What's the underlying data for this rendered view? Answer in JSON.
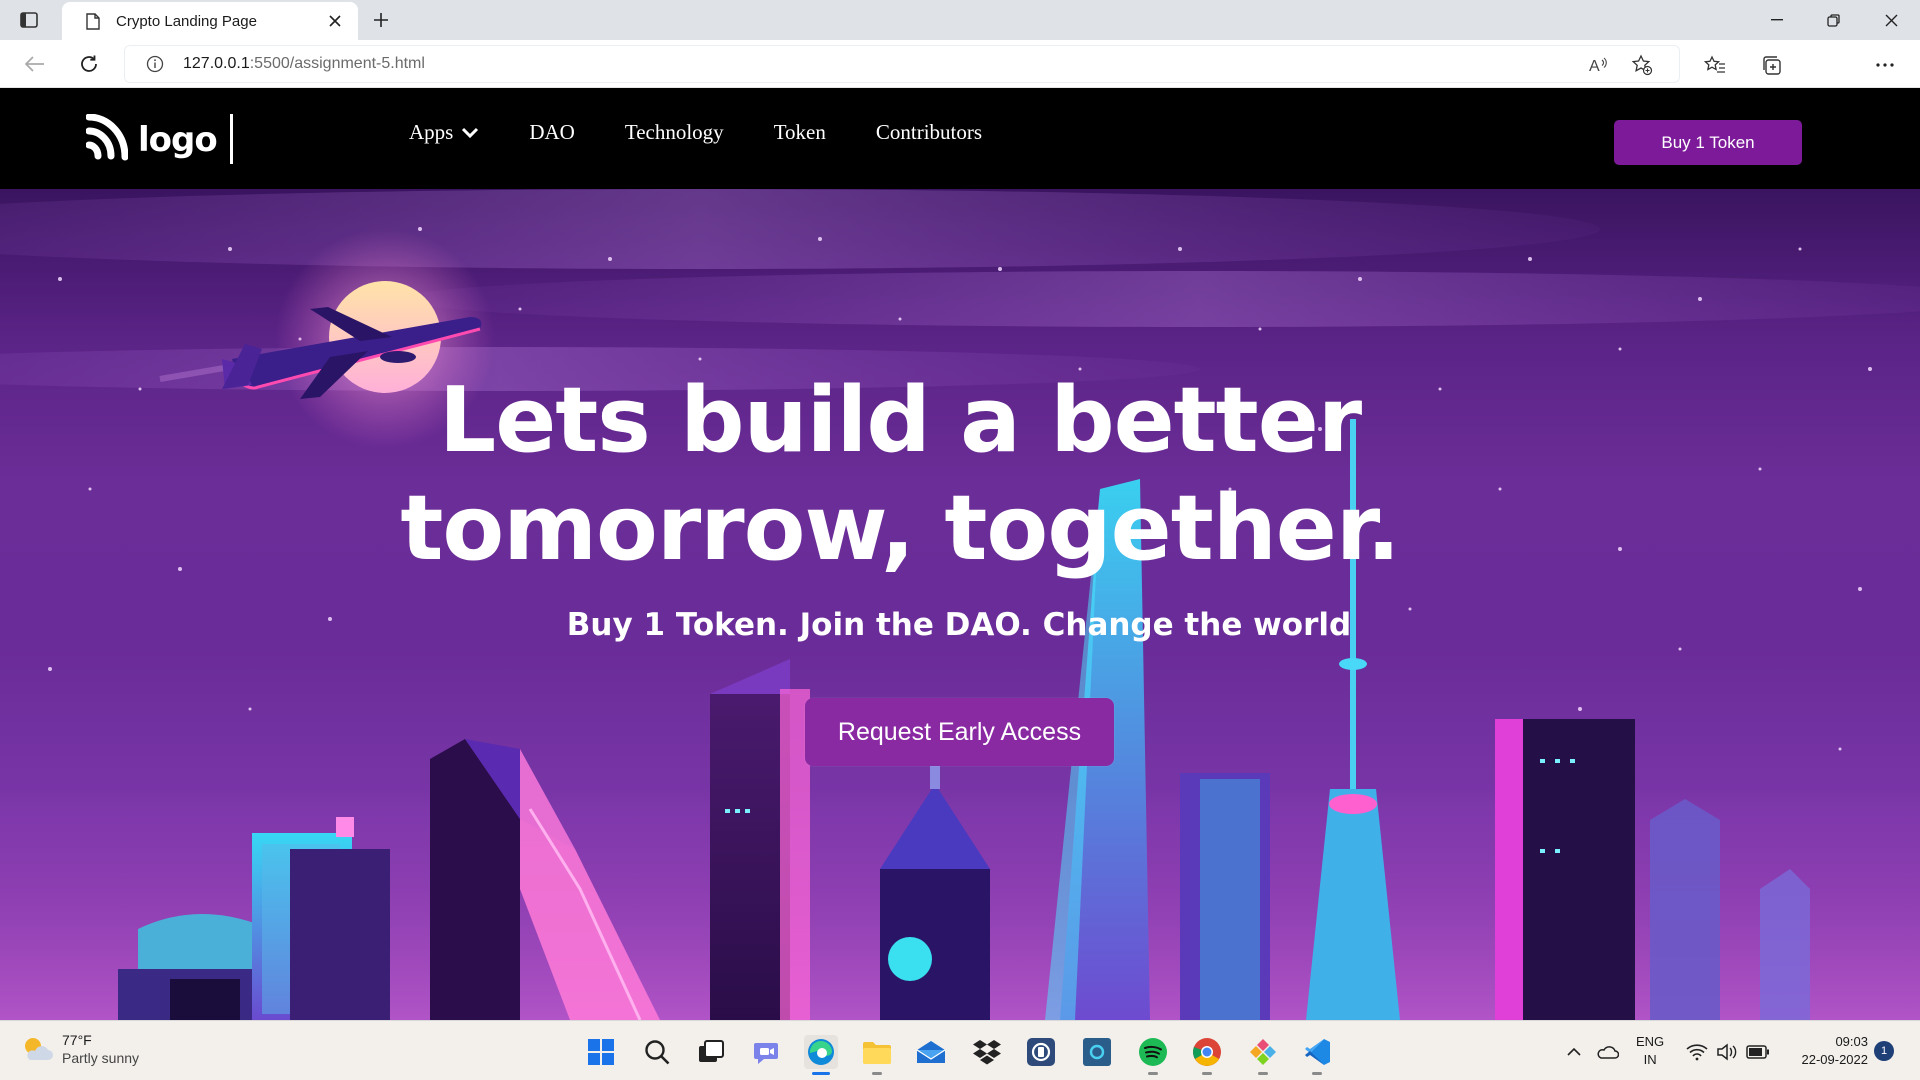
{
  "browser": {
    "tab_title": "Crypto Landing Page",
    "url_host": "127.0.0.1",
    "url_rest": ":5500/assignment-5.html"
  },
  "nav": {
    "logo_text": "logo",
    "links": [
      {
        "label": "Apps",
        "has_dropdown": true
      },
      {
        "label": "DAO"
      },
      {
        "label": "Technology"
      },
      {
        "label": "Token"
      },
      {
        "label": "Contributors"
      }
    ],
    "buy_button": "Buy 1 Token"
  },
  "hero": {
    "title_line1": "Lets build a better",
    "title_line2": "tomorrow, together.",
    "subtitle": "Buy 1 Token. Join the DAO. Change the world",
    "cta": "Request Early Access"
  },
  "taskbar": {
    "weather_temp": "77°F",
    "weather_desc": "Partly sunny",
    "apps": [
      "windows-start",
      "search",
      "task-view",
      "teams-chat",
      "edge",
      "file-explorer",
      "mail",
      "dropbox",
      "app-generic",
      "cortana",
      "spotify",
      "chrome",
      "git-tool",
      "vscode"
    ],
    "lang_line1": "ENG",
    "lang_line2": "IN",
    "time": "09:03",
    "date": "22-09-2022",
    "notification_count": "1"
  },
  "colors": {
    "nav_bg": "#000000",
    "accent_purple": "#7d1a9a",
    "hero_purple": "#6b2d97",
    "taskbar_bg": "#f3f0ec"
  }
}
